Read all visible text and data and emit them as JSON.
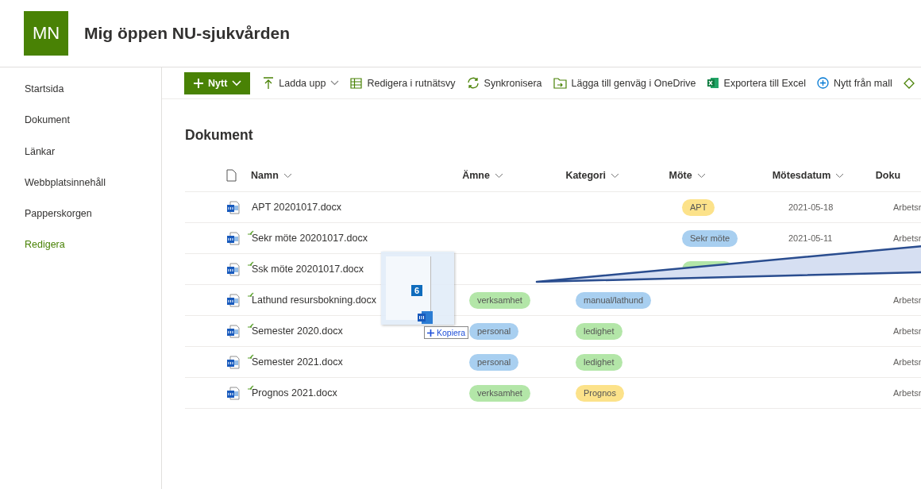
{
  "site": {
    "logo": "MN",
    "title": "Mig öppen NU-sjukvården"
  },
  "sidebar": {
    "items": [
      {
        "label": "Startsida",
        "kind": "nav"
      },
      {
        "label": "Dokument",
        "kind": "nav"
      },
      {
        "label": "Länkar",
        "kind": "nav"
      },
      {
        "label": "Webbplatsinnehåll",
        "kind": "nav"
      },
      {
        "label": "Papperskorgen",
        "kind": "nav"
      },
      {
        "label": "Redigera",
        "kind": "edit"
      }
    ]
  },
  "toolbar": [
    {
      "label": "Nytt",
      "kind": "new",
      "dropdown": true
    },
    {
      "label": "Ladda upp",
      "kind": "upload",
      "dropdown": true
    },
    {
      "label": "Redigera i rutnätsvy",
      "kind": "grid",
      "dropdown": false
    },
    {
      "label": "Synkronisera",
      "kind": "sync",
      "dropdown": false
    },
    {
      "label": "Lägga till genväg i OneDrive",
      "kind": "shortcut",
      "dropdown": false
    },
    {
      "label": "Exportera till Excel",
      "kind": "export",
      "dropdown": false
    },
    {
      "label": "Nytt från mall",
      "kind": "template",
      "dropdown": false
    },
    {
      "kind": "more"
    }
  ],
  "library": {
    "heading": "Dokument",
    "columns": [
      "Namn",
      "Ämne",
      "Kategori",
      "Möte",
      "Mötesdatum",
      "Doku"
    ],
    "rows": [
      {
        "name": "APT 20201017.docx",
        "new": false,
        "amne": null,
        "kategori": null,
        "mote": {
          "label": "APT",
          "color": "#fce28a"
        },
        "datum": "2021-05-18",
        "dokument": "Arbetsr"
      },
      {
        "name": "Sekr möte 20201017.docx",
        "new": true,
        "amne": null,
        "kategori": null,
        "mote": {
          "label": "Sekr möte",
          "color": "#a8cff0"
        },
        "datum": "2021-05-11",
        "dokument": "Arbetsr"
      },
      {
        "name": "Ssk möte 20201017.docx",
        "new": true,
        "amne": null,
        "kategori": null,
        "mote": {
          "color": "#b3e6a8"
        },
        "datum": null,
        "dokument": null
      },
      {
        "name": "Lathund resursbokning.docx",
        "new": true,
        "amne": {
          "label": "verksamhet",
          "color": "#b3e6a8"
        },
        "kategori": {
          "label": "manual/lathund",
          "color": "#a8cff0"
        },
        "mote": null,
        "datum": null,
        "dokument": "Arbetsr"
      },
      {
        "name": "Semester 2020.docx",
        "new": true,
        "amne": {
          "label": "personal",
          "color": "#a8cff0"
        },
        "kategori": {
          "label": "ledighet",
          "color": "#b3e6a8"
        },
        "mote": null,
        "datum": null,
        "dokument": "Arbetsr"
      },
      {
        "name": "Semester 2021.docx",
        "new": true,
        "amne": {
          "label": "personal",
          "color": "#a8cff0"
        },
        "kategori": {
          "label": "ledighet",
          "color": "#b3e6a8"
        },
        "mote": null,
        "datum": null,
        "dokument": "Arbetsr"
      },
      {
        "name": "Prognos 2021.docx",
        "new": true,
        "amne": {
          "label": "verksamhet",
          "color": "#b3e6a8"
        },
        "kategori": {
          "label": "Prognos",
          "color": "#fce28a"
        },
        "mote": null,
        "datum": null,
        "dokument": "Arbetsr"
      }
    ]
  },
  "drag": {
    "count": "6",
    "action": "Kopiera"
  }
}
